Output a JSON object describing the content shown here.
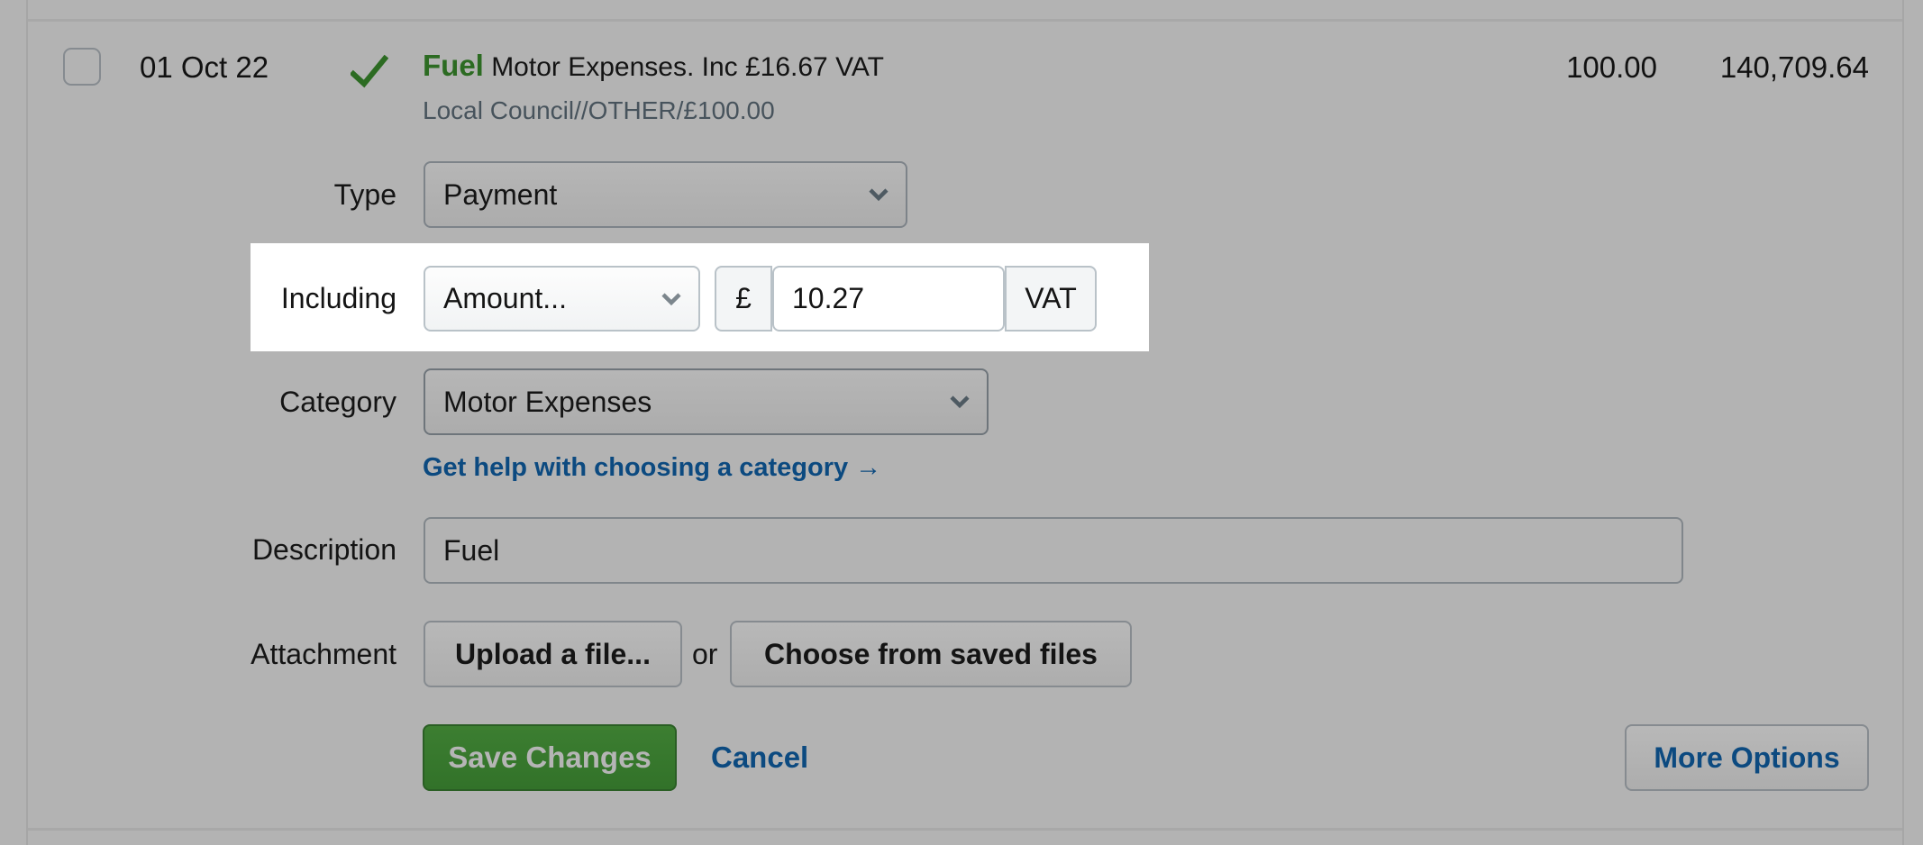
{
  "transaction": {
    "date": "01 Oct 22",
    "status_icon": "checkmark-icon",
    "category_name": "Fuel",
    "summary": "Motor Expenses. Inc £16.67 VAT",
    "reference": "Local Council//OTHER/£100.00",
    "amount": "100.00",
    "balance": "140,709.64"
  },
  "form": {
    "type": {
      "label": "Type",
      "value": "Payment"
    },
    "including": {
      "label": "Including",
      "mode_value": "Amount...",
      "currency_symbol": "£",
      "vat_amount": "10.27",
      "suffix": "VAT"
    },
    "category": {
      "label": "Category",
      "value": "Motor Expenses",
      "help_link": "Get help with choosing a category →"
    },
    "description": {
      "label": "Description",
      "value": "Fuel"
    },
    "attachment": {
      "label": "Attachment",
      "upload_button": "Upload a file...",
      "or_text": "or",
      "choose_button": "Choose from saved files"
    },
    "actions": {
      "save": "Save Changes",
      "cancel": "Cancel",
      "more": "More Options"
    }
  },
  "colors": {
    "accent_green": "#2c6b22",
    "link_blue": "#0c4a80",
    "overlay_grey": "#b3b3b3",
    "highlight": "#ffffff"
  }
}
